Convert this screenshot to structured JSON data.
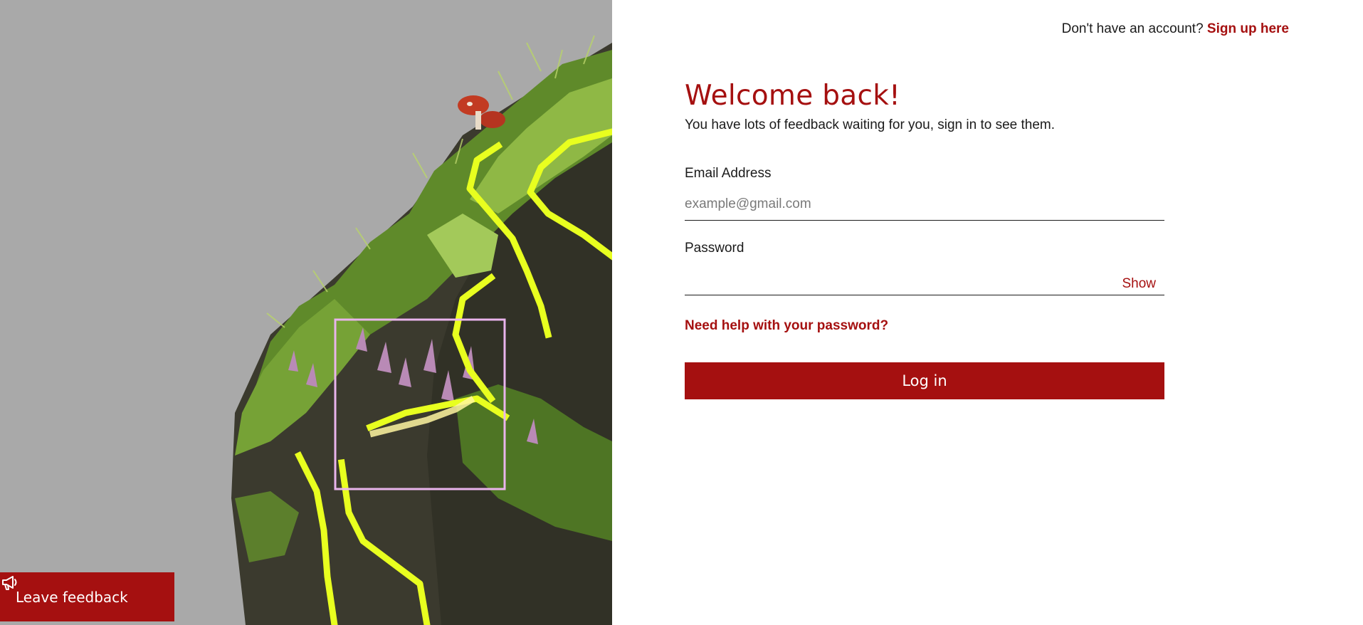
{
  "header": {
    "prompt_text": "Don't have an account?",
    "signup_link": "Sign up here"
  },
  "form": {
    "title": "Welcome back!",
    "subtitle": "You have lots of feedback waiting for you, sign in to see them.",
    "email": {
      "label": "Email Address",
      "placeholder": "example@gmail.com",
      "value": ""
    },
    "password": {
      "label": "Password",
      "value": "",
      "toggle_label": "Show"
    },
    "help_link": "Need help with your password?",
    "submit_label": "Log in"
  },
  "feedback_button": {
    "label": "Leave feedback",
    "icon": "megaphone-icon"
  },
  "colors": {
    "brand": "#a51010",
    "panel_bg": "#a9a9a9",
    "highlight": "#e8ff1f",
    "frame": "#e9b4ec"
  }
}
